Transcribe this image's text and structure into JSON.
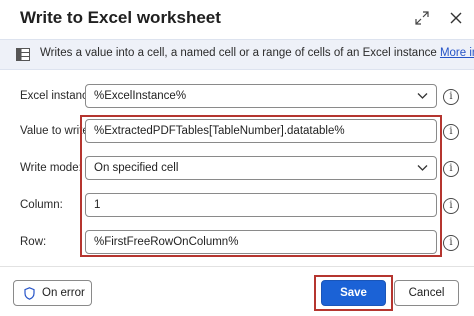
{
  "dialog": {
    "title": "Write to Excel worksheet"
  },
  "banner": {
    "text": "Writes a value into a cell, a named cell or a range of cells of an Excel instance",
    "link": "More info"
  },
  "form": {
    "excel_instance": {
      "label": "Excel instance:",
      "value": "%ExcelInstance%"
    },
    "value_to_write": {
      "label": "Value to write:",
      "value": "%ExtractedPDFTables[TableNumber].datatable%"
    },
    "write_mode": {
      "label": "Write mode:",
      "value": "On specified cell"
    },
    "column": {
      "label": "Column:",
      "value": "1"
    },
    "row": {
      "label": "Row:",
      "value": "%FirstFreeRowOnColumn%"
    }
  },
  "footer": {
    "on_error_label": "On error",
    "save_label": "Save",
    "cancel_label": "Cancel"
  },
  "info_glyph": "i",
  "colors": {
    "primary": "#1b62d6",
    "highlight": "#b5352f",
    "banner_bg": "#eef1f8",
    "link": "#2553c7"
  },
  "icons": [
    "expand-icon",
    "close-icon",
    "excel-icon",
    "chevron-down-icon",
    "info-icon",
    "shield-icon"
  ]
}
